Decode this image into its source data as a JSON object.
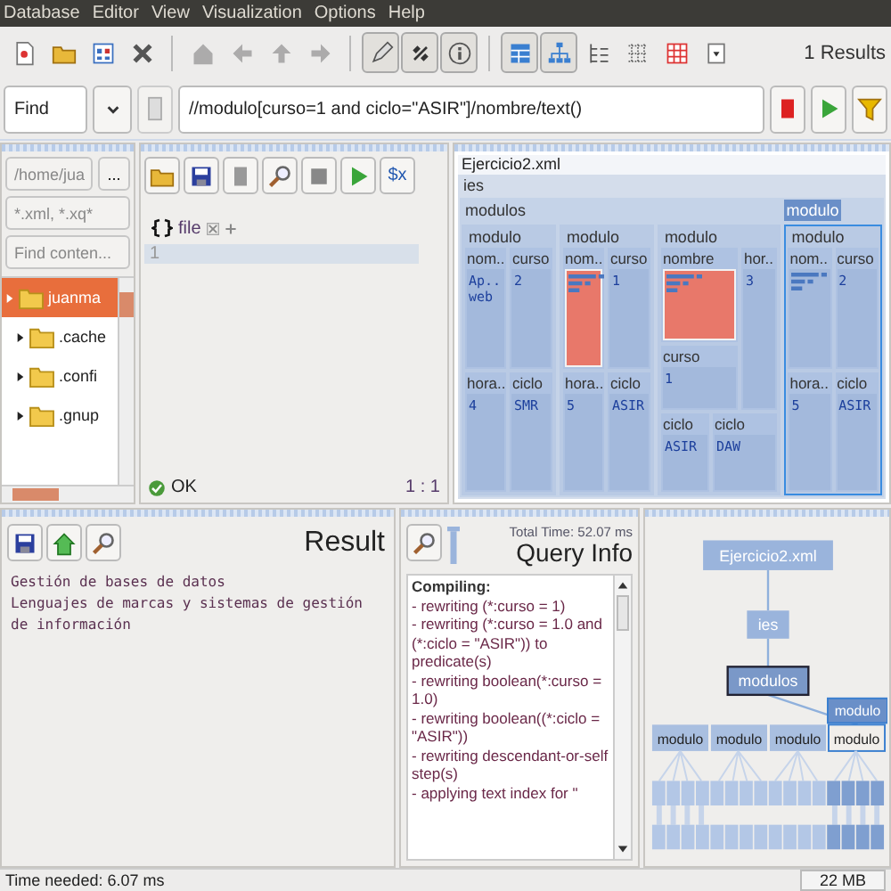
{
  "menu": [
    "Database",
    "Editor",
    "View",
    "Visualization",
    "Options",
    "Help"
  ],
  "toolbar": [
    {
      "kind": "new",
      "pressed": false,
      "disabled": false
    },
    {
      "kind": "open",
      "pressed": false,
      "disabled": false
    },
    {
      "kind": "props",
      "pressed": false,
      "disabled": false
    },
    {
      "kind": "close",
      "pressed": false,
      "disabled": false
    },
    {
      "kind": "sep"
    },
    {
      "kind": "home",
      "pressed": false,
      "disabled": true
    },
    {
      "kind": "back",
      "pressed": false,
      "disabled": true
    },
    {
      "kind": "up",
      "pressed": false,
      "disabled": true
    },
    {
      "kind": "forward",
      "pressed": false,
      "disabled": true
    },
    {
      "kind": "sep"
    },
    {
      "kind": "edit",
      "pressed": true,
      "disabled": false
    },
    {
      "kind": "xquery",
      "pressed": true,
      "disabled": false
    },
    {
      "kind": "info",
      "pressed": true,
      "disabled": false
    },
    {
      "kind": "sep"
    },
    {
      "kind": "map",
      "pressed": true,
      "disabled": false
    },
    {
      "kind": "tree",
      "pressed": true,
      "disabled": false
    },
    {
      "kind": "explorer",
      "pressed": false,
      "disabled": false
    },
    {
      "kind": "dots",
      "pressed": false,
      "disabled": false
    },
    {
      "kind": "table",
      "pressed": false,
      "disabled": false
    },
    {
      "kind": "dropdown",
      "pressed": false,
      "disabled": false
    }
  ],
  "results_count": "1 Results",
  "find_bar": {
    "mode": "Find",
    "query": "//modulo[curso=1 and ciclo=\"ASIR\"]/nombre/text()"
  },
  "file_browser": {
    "path": "/home/jua",
    "browse": "...",
    "filter": "*.xml, *.xq*",
    "search": {
      "placeholder": "Find conten..."
    },
    "tree": [
      {
        "label": "juanma",
        "selected": true,
        "children": [
          {
            "label": ".cache",
            "selected": false
          },
          {
            "label": ".confi",
            "selected": false
          },
          {
            "label": ".gnup",
            "selected": false
          }
        ]
      }
    ]
  },
  "editor": {
    "toolbar": [
      {
        "kind": "open"
      },
      {
        "kind": "save"
      },
      {
        "kind": "blank"
      },
      {
        "kind": "search"
      },
      {
        "kind": "stop"
      },
      {
        "kind": "run"
      },
      {
        "kind": "var",
        "label": "$x"
      }
    ],
    "tab": "file",
    "lines": [
      "1"
    ],
    "status": "OK",
    "position": "1 : 1"
  },
  "map": {
    "document": "Ejercicio2.xml",
    "root": "ies",
    "container": "modulos",
    "hover_label": "modulo",
    "modulos": [
      {
        "label": "modulo",
        "selected": false,
        "fields": [
          {
            "name": "nom..",
            "kind": "text",
            "value": "Ap.. web",
            "highlight": false
          },
          {
            "name": "curso",
            "kind": "text",
            "value": "2",
            "highlight": false
          },
          {
            "name": "hora..",
            "kind": "text",
            "value": "4",
            "highlight": false
          },
          {
            "name": "ciclo",
            "kind": "text",
            "value": "SMR",
            "highlight": false
          }
        ]
      },
      {
        "label": "modulo",
        "selected": false,
        "fields": [
          {
            "name": "nom..",
            "kind": "bars",
            "highlight": true
          },
          {
            "name": "curso",
            "kind": "text",
            "value": "1",
            "highlight": false
          },
          {
            "name": "hora..",
            "kind": "text",
            "value": "5",
            "highlight": false
          },
          {
            "name": "ciclo",
            "kind": "text",
            "value": "ASIR",
            "highlight": false
          }
        ]
      },
      {
        "label": "modulo",
        "selected": false,
        "fields": [
          {
            "name": "nombre",
            "kind": "bars",
            "highlight": true
          },
          {
            "name": "hor..",
            "kind": "text",
            "value": "3",
            "highlight": false
          },
          {
            "name": "curso",
            "kind": "text",
            "value": "1",
            "highlight": false
          },
          {
            "name": "ciclo",
            "kind": "text",
            "value": "ASIR",
            "highlight": false
          },
          {
            "name": "ciclo",
            "kind": "text",
            "value": "DAW",
            "highlight": false
          }
        ]
      },
      {
        "label": "modulo",
        "selected": true,
        "fields": [
          {
            "name": "nom..",
            "kind": "bars",
            "highlight": false
          },
          {
            "name": "curso",
            "kind": "text",
            "value": "2",
            "highlight": false
          },
          {
            "name": "hora..",
            "kind": "text",
            "value": "5",
            "highlight": false
          },
          {
            "name": "ciclo",
            "kind": "text",
            "value": "ASIR",
            "highlight": false
          }
        ]
      }
    ]
  },
  "result": {
    "title": "Result",
    "lines": [
      "Gestión de bases de datos",
      "Lenguajes de marcas y sistemas de gestión de información"
    ]
  },
  "query_info": {
    "total_time": "Total Time: 52.07 ms",
    "title": "Query Info",
    "heading": "Compiling:",
    "lines": [
      "- rewriting (*:curso = 1)",
      "- rewriting (*:curso = 1.0 and (*:ciclo = \"ASIR\")) to predicate(s)",
      "- rewriting boolean(*:curso = 1.0)",
      "- rewriting boolean((*:ciclo = \"ASIR\"))",
      "- rewriting descendant-or-self step(s)",
      "- applying text index for \""
    ]
  },
  "tree_view": {
    "hover_label": "modulo",
    "root": {
      "label": "Ejercicio2.xml",
      "selected": false,
      "children": [
        {
          "label": "ies",
          "selected": false,
          "children": [
            {
              "label": "modulos",
              "selected": true,
              "children": [
                {
                  "label": "modulo",
                  "selected": false
                },
                {
                  "label": "modulo",
                  "selected": false
                },
                {
                  "label": "modulo",
                  "selected": false
                },
                {
                  "label": "modulo",
                  "selected": true
                }
              ]
            }
          ]
        }
      ]
    }
  },
  "status_bar": {
    "time": "Time needed: 6.07 ms",
    "memory": "22 MB"
  }
}
